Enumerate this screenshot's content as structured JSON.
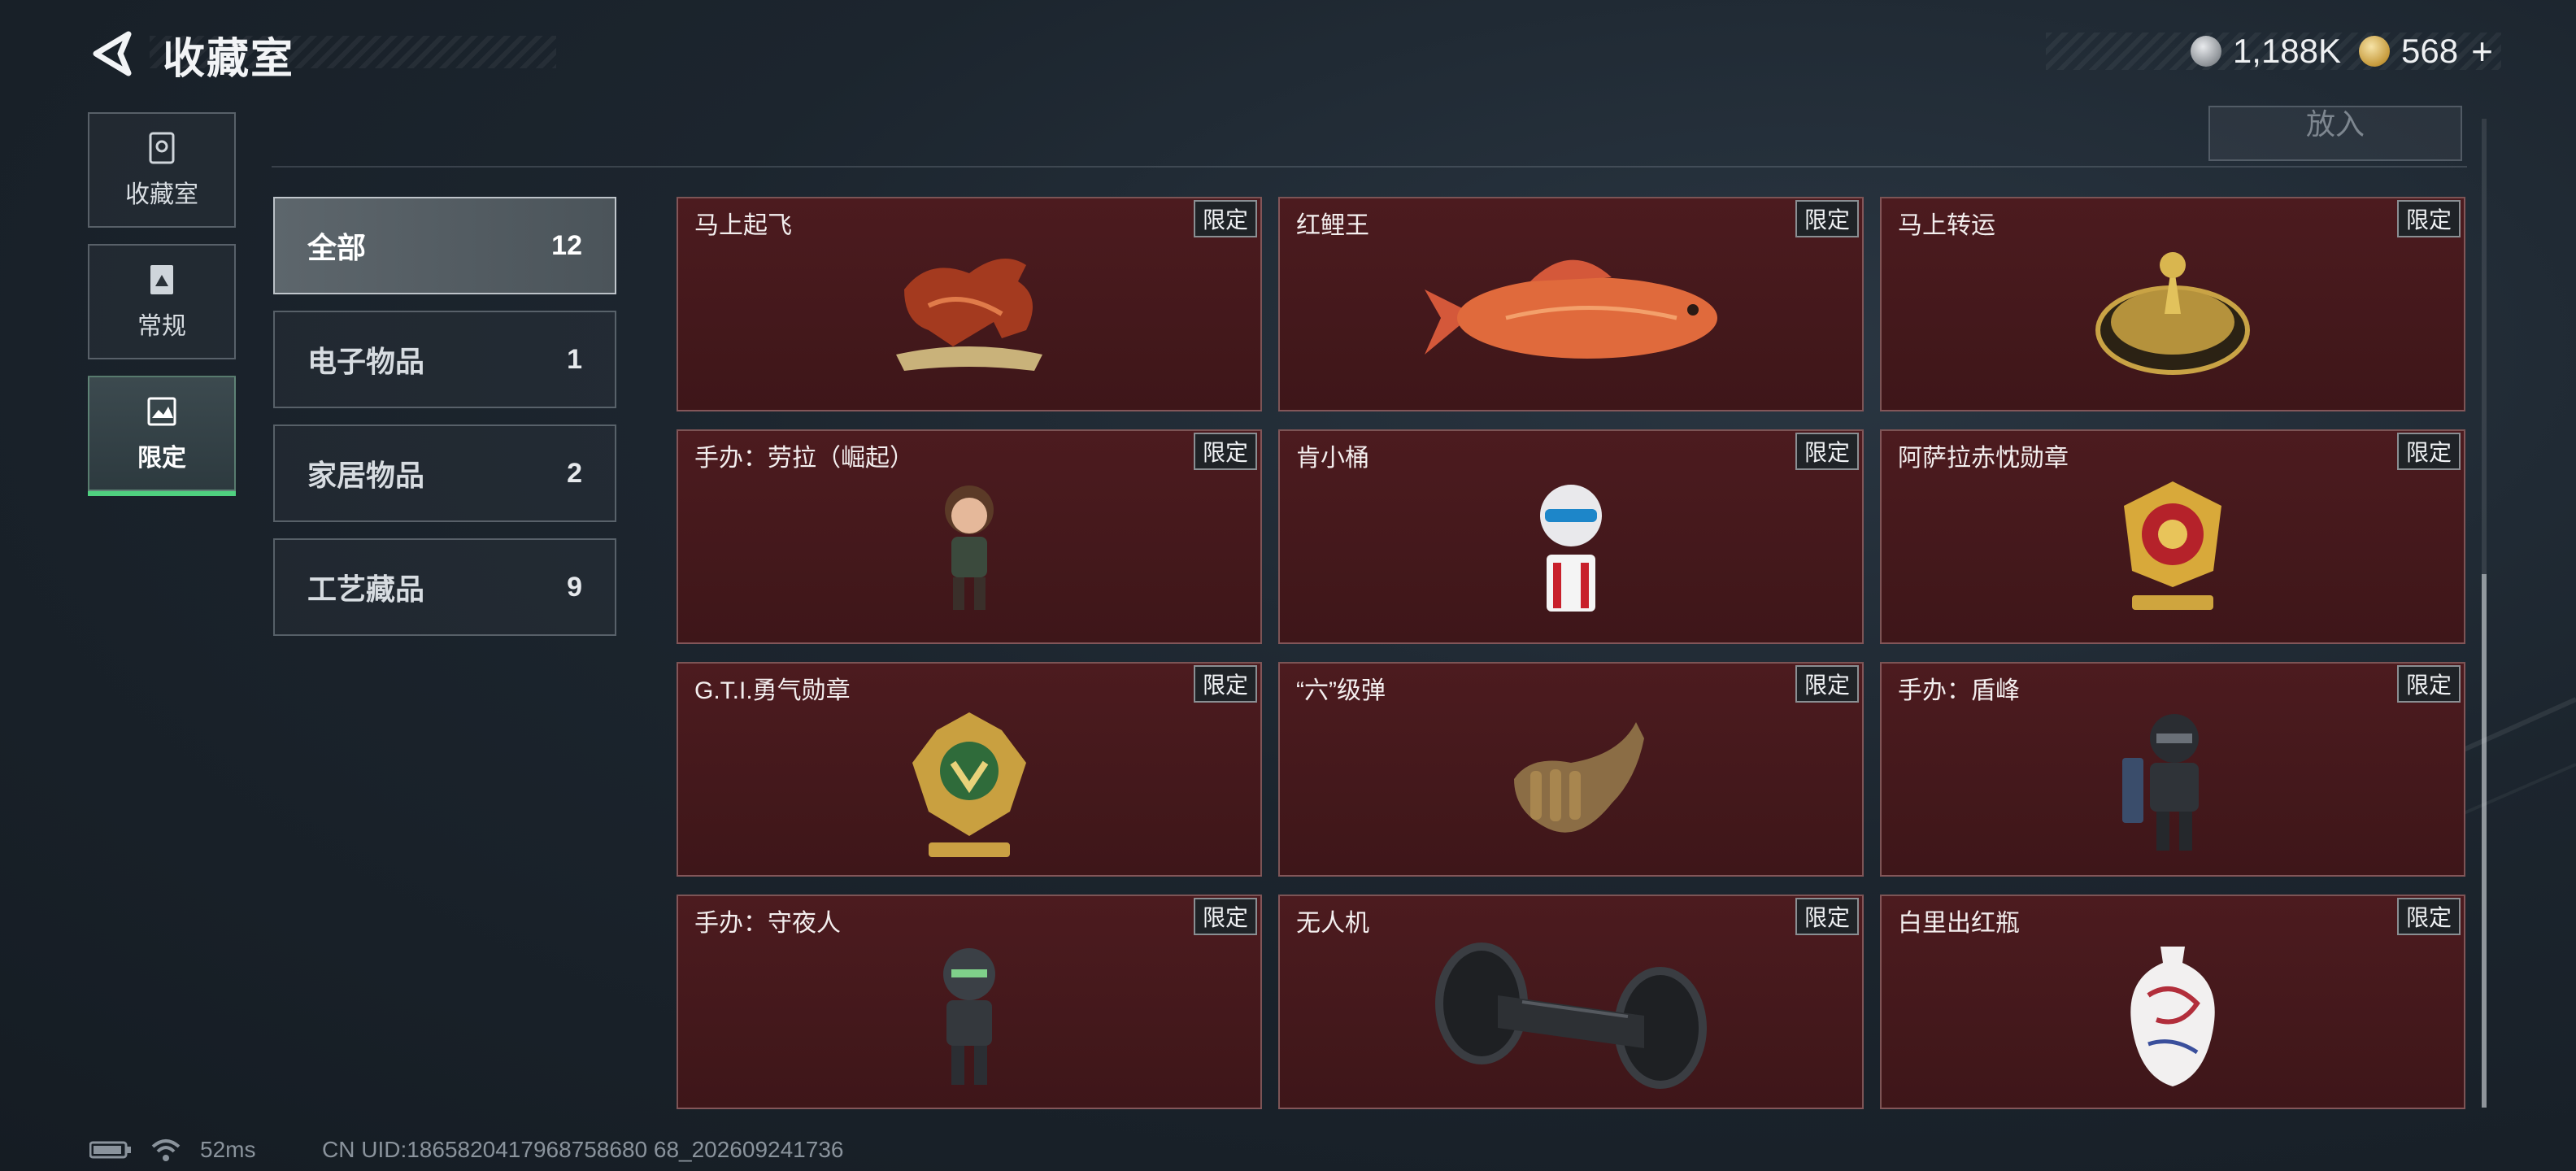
{
  "header": {
    "title": "收藏室",
    "currencies": [
      {
        "icon": "silver-coin-icon",
        "value": "1,188K"
      },
      {
        "icon": "gold-coin-icon",
        "value": "568"
      }
    ],
    "gold_plus": "+"
  },
  "rail": [
    {
      "label": "收藏室",
      "icon": "collection-room-icon",
      "active": false
    },
    {
      "label": "常规",
      "icon": "regular-icon",
      "active": false
    },
    {
      "label": "限定",
      "icon": "limited-icon",
      "active": true
    }
  ],
  "top": {
    "put_in_label": "放入"
  },
  "categories": [
    {
      "name": "全部",
      "count": "12",
      "active": true
    },
    {
      "name": "电子物品",
      "count": "1",
      "active": false
    },
    {
      "name": "家居物品",
      "count": "2",
      "active": false
    },
    {
      "name": "工艺藏品",
      "count": "9",
      "active": false
    }
  ],
  "badge_label": "限定",
  "items": [
    {
      "name": "马上起飞",
      "icon": "horse-statue-icon"
    },
    {
      "name": "红鲤王",
      "icon": "red-carp-icon"
    },
    {
      "name": "马上转运",
      "icon": "fortune-wheel-icon"
    },
    {
      "name": "手办：劳拉（崛起）",
      "icon": "lara-figure-icon"
    },
    {
      "name": "肯小桶",
      "icon": "kfc-figure-icon"
    },
    {
      "name": "阿萨拉赤忱勋章",
      "icon": "asara-medal-icon"
    },
    {
      "name": "G.T.I.勇气勋章",
      "icon": "gti-medal-icon"
    },
    {
      "name": "“六”级弹",
      "icon": "bullet-hand-icon"
    },
    {
      "name": "手办：盾峰",
      "icon": "shield-figure-icon"
    },
    {
      "name": "手办：守夜人",
      "icon": "nightwatch-figure-icon"
    },
    {
      "name": "无人机",
      "icon": "drone-icon"
    },
    {
      "name": "白里出红瓶",
      "icon": "porcelain-vase-icon"
    }
  ],
  "colors": {
    "card_bg": "#4c1b1f",
    "active_accent": "#4fd07f"
  },
  "footer": {
    "ping": "52ms",
    "uid": "CN UID:1865820417968758680 68_202609241736"
  }
}
